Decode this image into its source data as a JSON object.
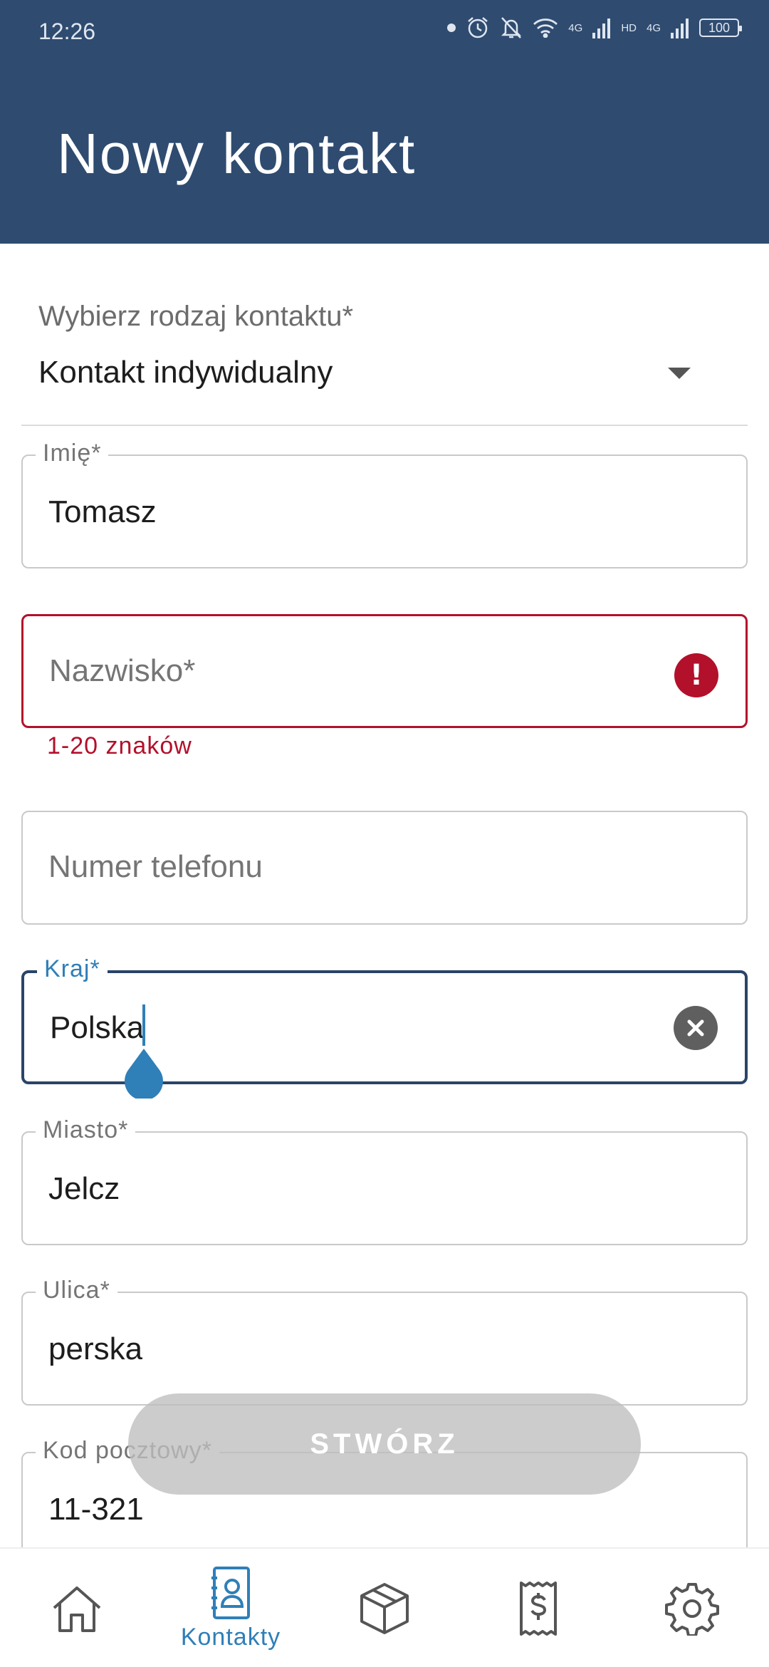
{
  "status_bar": {
    "time": "12:26",
    "network_1": "4G",
    "network_2": "HD",
    "network_3": "4G",
    "battery": "100"
  },
  "header": {
    "title": "Nowy kontakt"
  },
  "form": {
    "contact_type": {
      "label": "Wybierz rodzaj kontaktu*",
      "value": "Kontakt indywidualny"
    },
    "first_name": {
      "label": "Imię*",
      "value": "Tomasz"
    },
    "last_name": {
      "placeholder": "Nazwisko*",
      "error": "1-20 znaków"
    },
    "phone": {
      "placeholder": "Numer telefonu"
    },
    "country": {
      "label": "Kraj*",
      "value": "Polska"
    },
    "city": {
      "label": "Miasto*",
      "value": "Jelcz"
    },
    "street": {
      "label": "Ulica*",
      "value": "perska"
    },
    "postal_code": {
      "label": "Kod pocztowy*",
      "value": "11-321"
    },
    "submit_label": "STWÓRZ"
  },
  "bottom_nav": {
    "items": [
      {
        "icon": "home-icon"
      },
      {
        "icon": "contacts-icon",
        "label": "Kontakty",
        "active": true
      },
      {
        "icon": "package-icon"
      },
      {
        "icon": "receipt-dollar-icon"
      },
      {
        "icon": "settings-gear-icon"
      }
    ]
  },
  "colors": {
    "header_bg": "#2f4b70",
    "accent": "#2f7fb8",
    "error": "#b3102b"
  }
}
